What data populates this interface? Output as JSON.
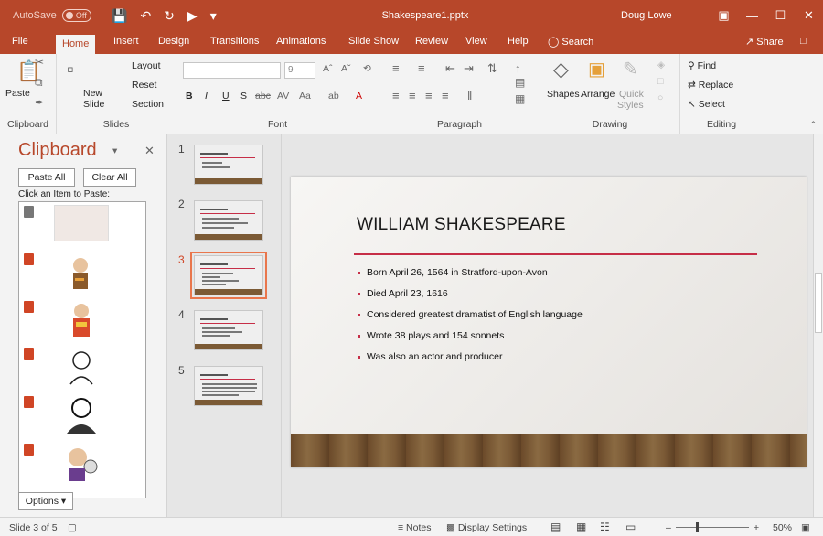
{
  "titlebar": {
    "autosave_label": "AutoSave",
    "autosave_state": "Off",
    "document_title": "Shakespeare1.pptx",
    "user_name": "Doug Lowe"
  },
  "tabs": [
    "File",
    "Home",
    "Insert",
    "Design",
    "Transitions",
    "Animations",
    "Slide Show",
    "Review",
    "View",
    "Help"
  ],
  "active_tab": "Home",
  "search_label": "Search",
  "share_label": "Share",
  "ribbon": {
    "clipboard": {
      "paste": "Paste",
      "group": "Clipboard"
    },
    "slides": {
      "new_slide_line1": "New",
      "new_slide_line2": "Slide",
      "layout": "Layout",
      "reset": "Reset",
      "section": "Section",
      "group": "Slides"
    },
    "font": {
      "size": "9",
      "group": "Font"
    },
    "paragraph": {
      "group": "Paragraph"
    },
    "drawing": {
      "shapes": "Shapes",
      "arrange": "Arrange",
      "quick_styles_line1": "Quick",
      "quick_styles_line2": "Styles",
      "group": "Drawing"
    },
    "editing": {
      "find": "Find",
      "replace": "Replace",
      "select": "Select",
      "group": "Editing"
    }
  },
  "clipboard_pane": {
    "title": "Clipboard",
    "paste_all": "Paste All",
    "clear_all": "Clear All",
    "instruction": "Click an Item to Paste:",
    "options": "Options"
  },
  "thumbnails": [
    {
      "number": "1",
      "selected": false
    },
    {
      "number": "2",
      "selected": false
    },
    {
      "number": "3",
      "selected": true
    },
    {
      "number": "4",
      "selected": false
    },
    {
      "number": "5",
      "selected": false
    }
  ],
  "slide": {
    "title": "WILLIAM SHAKESPEARE",
    "bullets": [
      "Born April 26, 1564 in Stratford-upon-Avon",
      "Died April 23, 1616",
      "Considered greatest dramatist of English language",
      "Wrote 38 plays and 154 sonnets",
      "Was also an actor and producer"
    ]
  },
  "statusbar": {
    "slide_info": "Slide 3 of 5",
    "notes": "Notes",
    "display_settings": "Display Settings",
    "zoom": "50%"
  },
  "colors": {
    "accent": "#b7472a",
    "rule": "#c62e47"
  }
}
